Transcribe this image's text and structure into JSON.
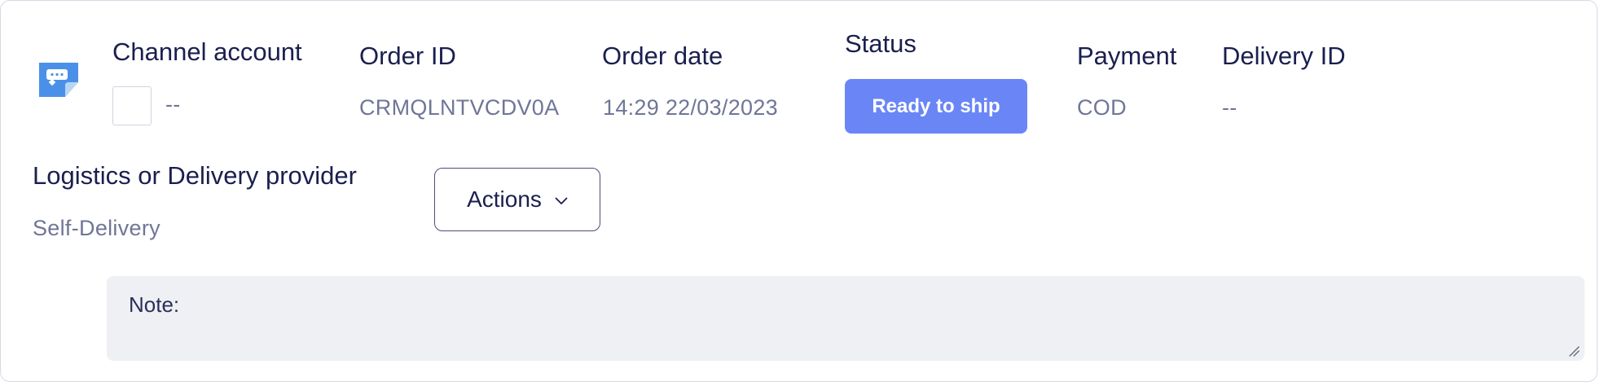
{
  "order": {
    "channel_account": {
      "heading": "Channel account",
      "value": "--"
    },
    "order_id": {
      "heading": "Order ID",
      "value": "CRMQLNTVCDV0A"
    },
    "order_date": {
      "heading": "Order date",
      "value": "14:29 22/03/2023"
    },
    "status": {
      "heading": "Status",
      "value": "Ready to ship"
    },
    "payment": {
      "heading": "Payment",
      "value": "COD"
    },
    "delivery_id": {
      "heading": "Delivery ID",
      "value": "--"
    }
  },
  "logistics": {
    "heading": "Logistics or Delivery provider",
    "value": "Self-Delivery"
  },
  "actions": {
    "label": "Actions",
    "icon": "chevron-down-icon"
  },
  "note": {
    "label": "Note:",
    "value": ""
  },
  "icons": {
    "channel": "chat-bubble-icon"
  },
  "colors": {
    "status_bg": "#6a86f6",
    "icon_blue": "#4a90e8",
    "heading_text": "#1a1f4f",
    "value_text": "#6f7697",
    "note_bg": "#eff0f4"
  }
}
